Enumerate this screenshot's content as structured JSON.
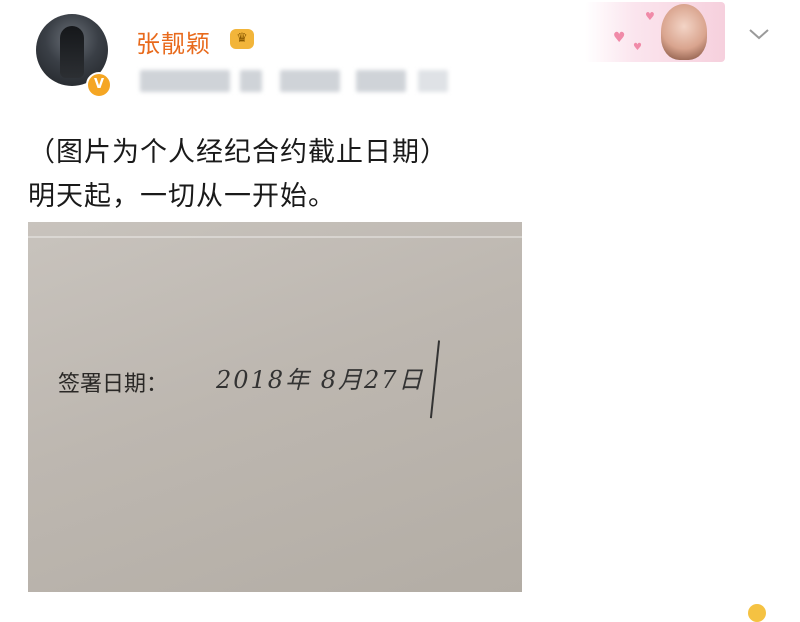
{
  "post": {
    "author": {
      "name": "张靓颖",
      "verified_badge": "V"
    },
    "text_lines": [
      "（图片为个人经纪合约截止日期）",
      "明天起，一切从一开始。"
    ],
    "photo": {
      "label": "签署日期：",
      "handwritten_date": "2018年 8月27日"
    }
  },
  "icons": {
    "crown": "crown-icon",
    "chevron": "chevron-down-icon",
    "verified": "verified-v-icon"
  },
  "colors": {
    "username": "#e86a1c",
    "verified_badge": "#f5a623",
    "crown": "#f2b53a"
  }
}
